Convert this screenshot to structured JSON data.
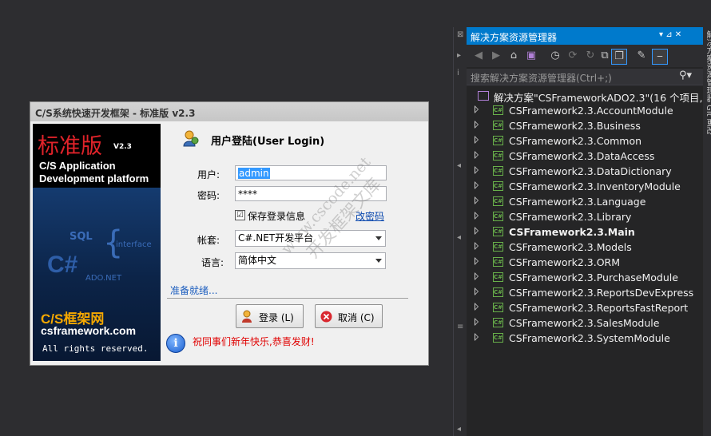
{
  "dialog": {
    "title": "C/S系统快速开发框架 - 标准版 v2.3",
    "banner": {
      "edition": "标准版",
      "version": "V2.3",
      "line1": "C/S Application",
      "line2": "Development platform",
      "sql": "SQL",
      "interface": "interface",
      "csharp": "C#",
      "ado": "ADO.NET",
      "brand": "C/S框架网",
      "url": "csframework.com",
      "rights": "All rights reserved."
    },
    "header": "用户登陆(User Login)",
    "user_label": "用户:",
    "user_value": "admin",
    "password_label": "密码:",
    "password_value": "****",
    "remember_label": "保存登录信息",
    "remember_checked": "☑",
    "change_password": "改密码",
    "account_label": "帐套:",
    "account_value": "C#.NET开发平台",
    "language_label": "语言:",
    "language_value": "简体中文",
    "status": "准备就绪...",
    "login_button": "登录 (L)",
    "cancel_button": "取消 (C)",
    "message": "祝同事们新年快乐,恭喜发财!",
    "watermark1": "www.cscode.net",
    "watermark2": "开发框架文库"
  },
  "solution_explorer": {
    "title": "解决方案资源管理器",
    "pin": "▾ ⊿ ✕",
    "search_placeholder": "搜索解决方案资源管理器(Ctrl+;)",
    "solution": "解决方案\"CSFrameworkADO2.3\"(16 个项目, 共",
    "projects": [
      {
        "name": "CSFramework2.3.AccountModule",
        "bold": false
      },
      {
        "name": "CSFramework2.3.Business",
        "bold": false
      },
      {
        "name": "CSFramework2.3.Common",
        "bold": false
      },
      {
        "name": "CSFramework2.3.DataAccess",
        "bold": false
      },
      {
        "name": "CSFramework2.3.DataDictionary",
        "bold": false
      },
      {
        "name": "CSFramework2.3.InventoryModule",
        "bold": false
      },
      {
        "name": "CSFramework2.3.Language",
        "bold": false
      },
      {
        "name": "CSFramework2.3.Library",
        "bold": false
      },
      {
        "name": "CSFramework2.3.Main",
        "bold": true
      },
      {
        "name": "CSFramework2.3.Models",
        "bold": false
      },
      {
        "name": "CSFramework2.3.ORM",
        "bold": false
      },
      {
        "name": "CSFramework2.3.PurchaseModule",
        "bold": false
      },
      {
        "name": "CSFramework2.3.ReportsDevExpress",
        "bold": false
      },
      {
        "name": "CSFramework2.3.ReportsFastReport",
        "bold": false
      },
      {
        "name": "CSFramework2.3.SalesModule",
        "bold": false
      },
      {
        "name": "CSFramework2.3.SystemModule",
        "bold": false
      }
    ]
  },
  "right_strip": "解决方案资源管理器  Git 更改"
}
